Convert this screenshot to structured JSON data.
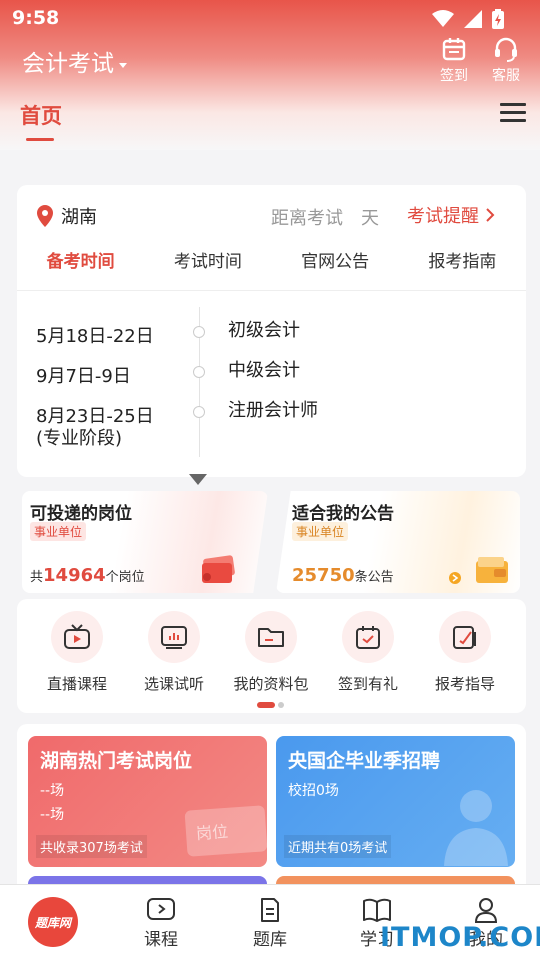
{
  "status": {
    "time": "9:58"
  },
  "header": {
    "title": "会计考试",
    "checkin_label": "签到",
    "service_label": "客服",
    "tab_home": "首页"
  },
  "exam_card": {
    "location": "湖南",
    "distance_label": "距离考试",
    "day_label": "天",
    "reminder_label": "考试提醒",
    "tabs": [
      "备考时间",
      "考试时间",
      "官网公告",
      "报考指南"
    ],
    "schedule": [
      {
        "date": "5月18日-22日",
        "exam": "初级会计"
      },
      {
        "date": "9月7日-9日",
        "exam": "中级会计"
      },
      {
        "date": "8月23日-25日",
        "exam": "注册会计师"
      }
    ],
    "date_note": "(专业阶段)"
  },
  "promos": [
    {
      "title": "可投递的岗位",
      "tag": "事业单位",
      "prefix": "共",
      "count": "14964",
      "suffix": "个岗位"
    },
    {
      "title": "适合我的公告",
      "tag": "事业单位",
      "count": "25750",
      "suffix": "条公告"
    }
  ],
  "shortcuts": [
    {
      "label": "直播课程",
      "icon": "tv-icon"
    },
    {
      "label": "选课试听",
      "icon": "chart-board-icon"
    },
    {
      "label": "我的资料包",
      "icon": "folder-icon"
    },
    {
      "label": "签到有礼",
      "icon": "calendar-check-icon"
    },
    {
      "label": "报考指导",
      "icon": "edit-doc-icon"
    }
  ],
  "hot": [
    {
      "title": "湖南热门考试岗位",
      "line1": "--场",
      "line2": "--场",
      "footer": "共收录307场考试",
      "color": "#f0696a"
    },
    {
      "title": "央国企毕业季招聘",
      "line1": "校招0场",
      "footer": "近期共有0场考试",
      "color": "#4b9bef"
    }
  ],
  "hot_badge_text": "岗位",
  "bottom_nav": [
    {
      "label": "题库网"
    },
    {
      "label": "课程",
      "icon": "play-icon"
    },
    {
      "label": "题库",
      "icon": "doc-icon"
    },
    {
      "label": "学习",
      "icon": "book-icon"
    },
    {
      "label": "我的",
      "icon": "user-icon"
    }
  ],
  "watermark": "ITMOP.COM",
  "colors": {
    "accent": "#e04b3f",
    "blue": "#4b9bef",
    "orange": "#e58b2c"
  }
}
